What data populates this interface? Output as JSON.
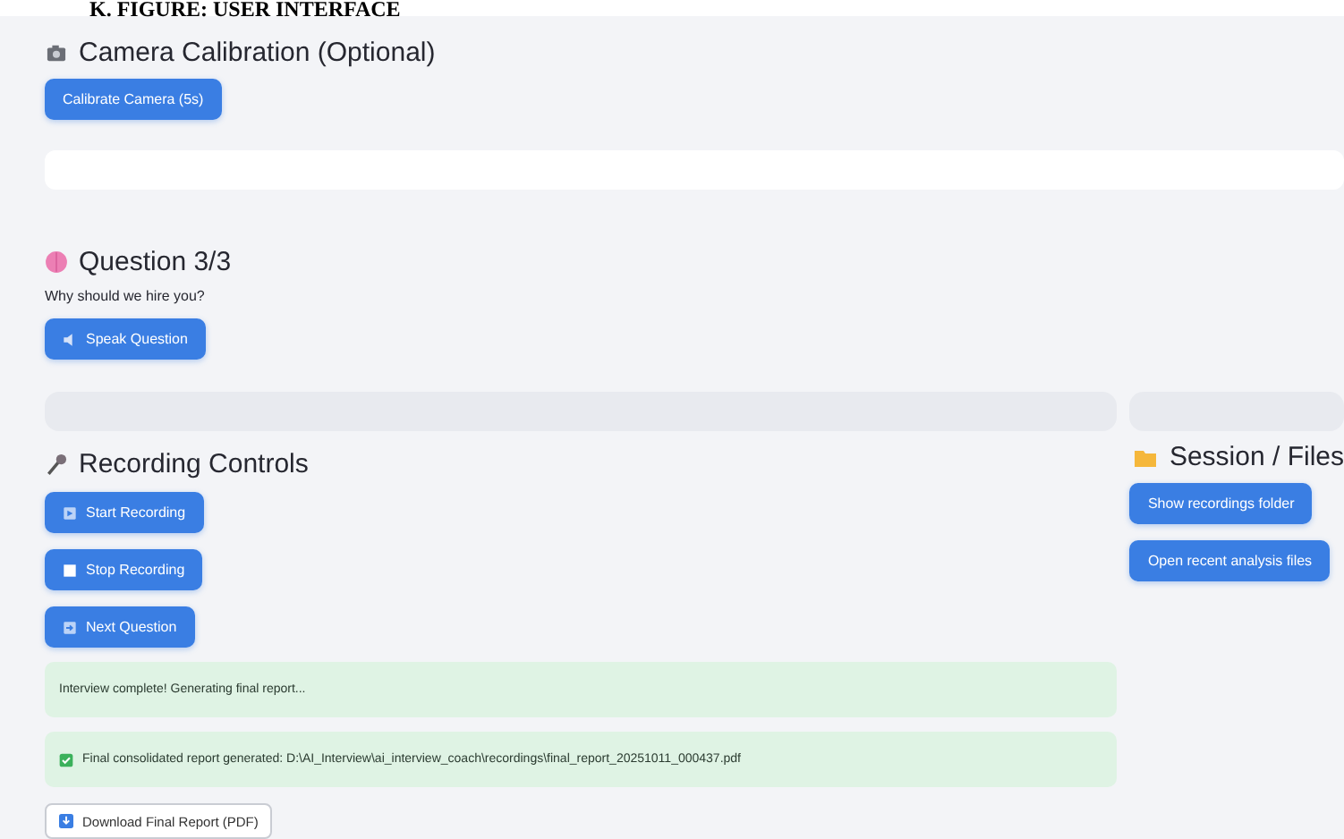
{
  "figure_caption": "K. FIGURE: USER INTERFACE",
  "camera": {
    "heading": "Camera Calibration (Optional)",
    "button": "Calibrate Camera (5s)"
  },
  "question": {
    "heading": "Question 3/3",
    "text": "Why should we hire you?",
    "button": "Speak Question"
  },
  "recording": {
    "heading": "Recording Controls",
    "buttons": [
      {
        "kind": "play",
        "label": "Start Recording"
      },
      {
        "kind": "stop",
        "label": "Stop Recording"
      },
      {
        "kind": "next",
        "label": "Next Question"
      }
    ],
    "messages": [
      {
        "kind": "plain",
        "text": "Interview complete! Generating final report..."
      },
      {
        "kind": "check",
        "text": "Final consolidated report generated: D:\\AI_Interview\\ai_interview_coach\\recordings\\final_report_20251011_000437.pdf"
      }
    ],
    "download_button": "Download Final Report (PDF)"
  },
  "session": {
    "heading": "Session / Files",
    "buttons": [
      "Show recordings folder",
      "Open recent analysis files"
    ]
  }
}
